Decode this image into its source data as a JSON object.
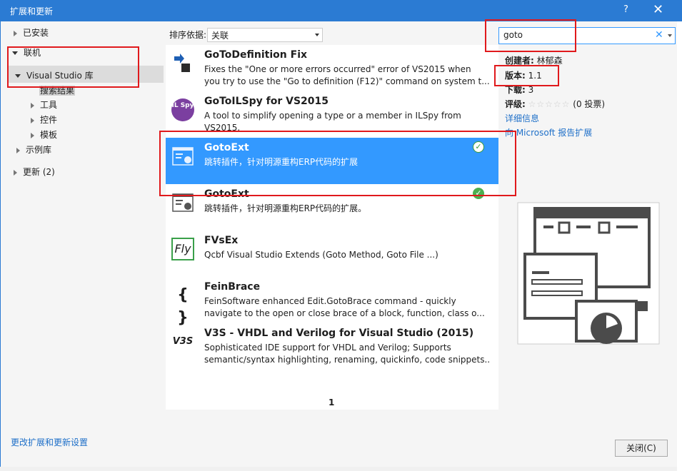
{
  "window": {
    "title": "扩展和更新",
    "help": "?",
    "close": "✕"
  },
  "nav": {
    "installed": "已安装",
    "online": "联机",
    "vs_gallery": "Visual Studio 库",
    "search_results": "搜索结果",
    "tools": "工具",
    "controls": "控件",
    "templates": "模板",
    "samples": "示例库",
    "updates": "更新 (2)"
  },
  "toolbar": {
    "sort_label": "排序依据:",
    "sort_value": "关联"
  },
  "search": {
    "value": "goto",
    "clear": "✕"
  },
  "results": [
    {
      "name": "GoToDefinition Fix",
      "desc1": "Fixes the \"One or more errors occurred\" error of VS2015 when",
      "desc2": "you try to use the \"Go to definition (F12)\" command on system t...",
      "icon": "arrow-doc-icon"
    },
    {
      "name": "GoToILSpy for VS2015",
      "desc1": "A tool to simplify opening a type or a member in ILSpy from",
      "desc2": "VS2015.",
      "icon": "ilspy-icon",
      "icon_text": "IL Spy"
    },
    {
      "name": "GotoExt",
      "desc1": "跳转插件，针对明源重构ERP代码的扩展",
      "desc2": "",
      "icon": "extension-window-icon",
      "check": "✓"
    },
    {
      "name": "GotoExt",
      "desc1": "跳转插件，针对明源重构ERP代码的扩展。",
      "desc2": "",
      "icon": "extension-window-icon",
      "check": "✓"
    },
    {
      "name": "FVsEx",
      "desc1": "Qcbf Visual Studio Extends (Goto Method, Goto File ...)",
      "desc2": "",
      "icon": "fly-icon",
      "icon_text": "Fly"
    },
    {
      "name": "FeinBrace",
      "desc1": "FeinSoftware enhanced Edit.GotoBrace command - quickly",
      "desc2": "navigate to the open or close brace of a block, function, class o...",
      "icon": "braces-icon",
      "icon_text": "{ }"
    },
    {
      "name": "V3S - VHDL and Verilog for Visual Studio (2015)",
      "desc1": "Sophisticated IDE support for VHDL and Verilog; Supports",
      "desc2": "semantic/syntax highlighting, renaming, quickinfo, code snippets...",
      "icon": "v3s-icon",
      "icon_text": "V3S"
    }
  ],
  "pager": {
    "page": "1"
  },
  "details": {
    "author_label": "创建者:",
    "author": "林郁森",
    "version_label": "版本:",
    "version": "1.1",
    "downloads_label": "下载:",
    "downloads": "3",
    "rating_label": "评级:",
    "stars": "☆☆☆☆☆",
    "votes": "(0 投票)",
    "more_info": "详细信息",
    "report": "向 Microsoft 报告扩展"
  },
  "footer": {
    "settings_link": "更改扩展和更新设置",
    "close_button": "关闭(C)"
  },
  "colors": {
    "accent": "#2b7bd3",
    "selection": "#3399ff",
    "annotation": "#e0191c",
    "link": "#1e6fc8"
  }
}
